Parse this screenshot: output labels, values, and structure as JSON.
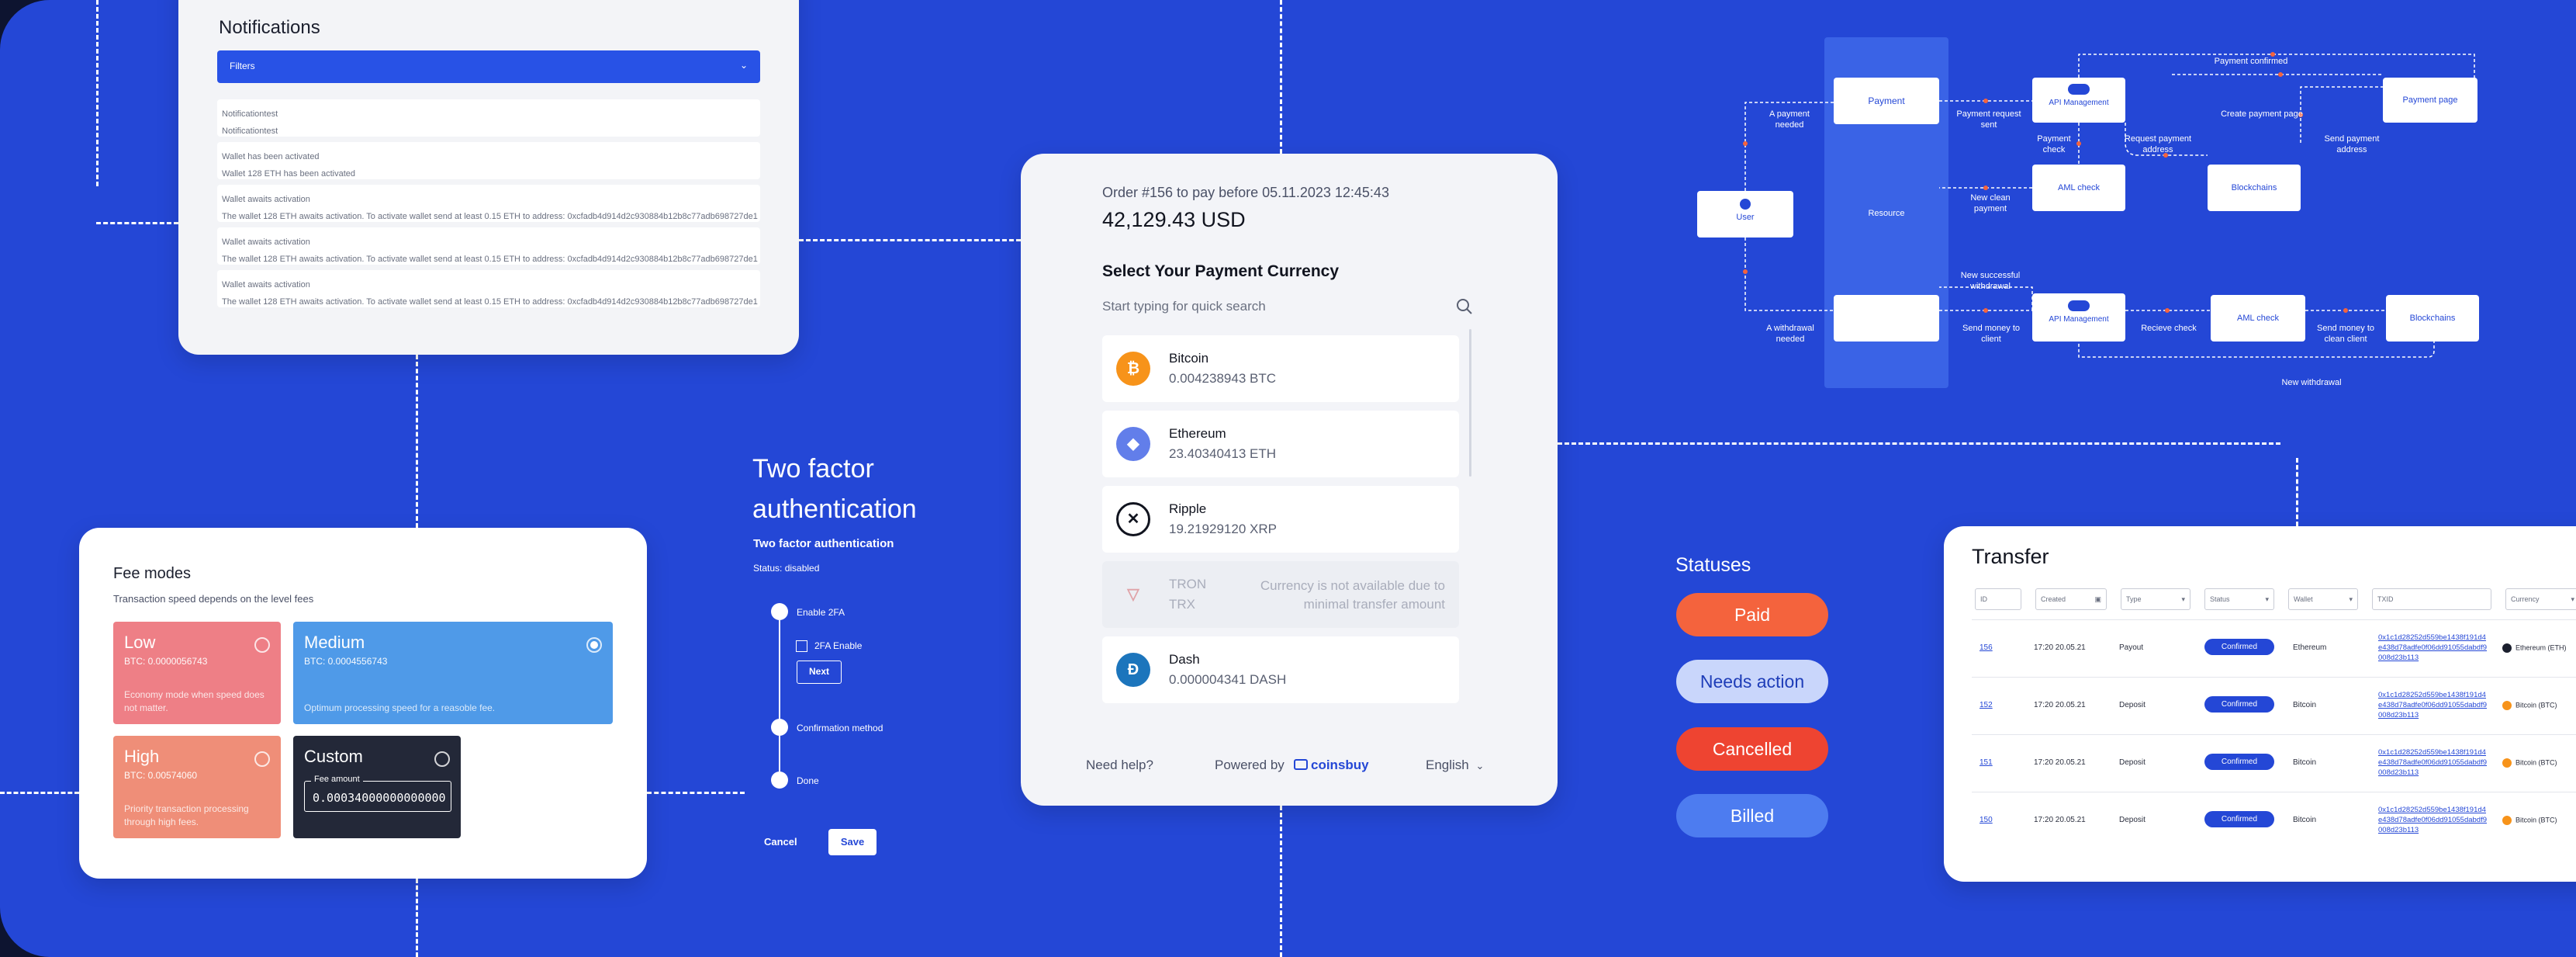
{
  "notifications": {
    "title": "Notifications",
    "filter_label": "Filters",
    "filter_chevron": "⌄",
    "items": [
      {
        "title": "Notificationtest",
        "body": "Notificationtest"
      },
      {
        "title": "Wallet has been activated",
        "body": "Wallet 128 ETH has been activated"
      },
      {
        "title": "Wallet awaits activation",
        "body": "The wallet 128 ETH awaits activation. To activate wallet send at least 0.15 ETH to address: 0xcfadb4d914d2c930884b12b8c77adb698727de1"
      },
      {
        "title": "Wallet awaits activation",
        "body": "The wallet 128 ETH awaits activation. To activate wallet send at least 0.15 ETH to address: 0xcfadb4d914d2c930884b12b8c77adb698727de1"
      },
      {
        "title": "Wallet awaits activation",
        "body": "The wallet 128 ETH awaits activation. To activate wallet send at least 0.15 ETH to address: 0xcfadb4d914d2c930884b12b8c77adb698727de1"
      }
    ]
  },
  "fee": {
    "title": "Fee modes",
    "subtitle": "Transaction speed depends on the level fees",
    "modes": [
      {
        "name": "Low",
        "btc": "BTC: 0.0000056743",
        "desc": "Economy mode when speed does not matter.",
        "color": "#ee7f86",
        "selected": false
      },
      {
        "name": "Medium",
        "btc": "BTC: 0.0004556743",
        "desc": "Optimum processing speed for a reasoble fee.",
        "color": "#4f9ae8",
        "selected": true
      },
      {
        "name": "High",
        "btc": "BTC: 0.00574060",
        "desc": "Priority transaction processing through high fees.",
        "color": "#ef8e78",
        "selected": false
      },
      {
        "name": "Custom",
        "btc": "",
        "desc": "",
        "color": "#232838",
        "selected": false
      }
    ],
    "custom_field_label": "Fee amount",
    "custom_field_value": "0.00034000000000000"
  },
  "tfa": {
    "title": "Two factor authentication",
    "subtitle": "Two factor authentication",
    "status": "Status: disabled",
    "steps": [
      "Enable 2FA",
      "Confirmation method",
      "Done"
    ],
    "checkbox_label": "2FA Enable",
    "next": "Next",
    "cancel": "Cancel",
    "save": "Save"
  },
  "payment": {
    "order": "Order #156 to pay before 05.11.2023 12:45:43",
    "amount": "42,129.43 USD",
    "select_title": "Select Your Payment Currency",
    "search_placeholder": "Start typing for quick search",
    "coins": [
      {
        "name": "Bitcoin",
        "balance": "0.004238943 BTC",
        "symbol": "₿",
        "color": "#f7931a",
        "available": true,
        "note": ""
      },
      {
        "name": "Ethereum",
        "balance": "23.40340413 ETH",
        "symbol": "◆",
        "color": "#627eea",
        "available": true,
        "note": ""
      },
      {
        "name": "Ripple",
        "balance": "19.21929120 XRP",
        "symbol": "✕",
        "color": "#11141f",
        "available": true,
        "note": ""
      },
      {
        "name": "TRON",
        "balance": "TRX",
        "symbol": "▽",
        "color": "#e0a3a8",
        "available": false,
        "note": "Currency is not available due to minimal transfer amount"
      },
      {
        "name": "Dash",
        "balance": "0.000004341 DASH",
        "symbol": "Đ",
        "color": "#1c75bc",
        "available": true,
        "note": ""
      }
    ],
    "help": "Need help?",
    "powered_by": "Powered by",
    "brand": "coinsbuy",
    "language": "English"
  },
  "statuses": {
    "title": "Statuses",
    "items": [
      {
        "label": "Paid",
        "bg": "#f4633d",
        "fg": "#ffffff"
      },
      {
        "label": "Needs action",
        "bg": "#c9d6fb",
        "fg": "#1e3db8"
      },
      {
        "label": "Cancelled",
        "bg": "#ee4431",
        "fg": "#ffffff"
      },
      {
        "label": "Billed",
        "bg": "#4d7cf0",
        "fg": "#ffffff"
      }
    ]
  },
  "transfer": {
    "title": "Transfer",
    "filters": [
      "ID",
      "Created",
      "Type",
      "Status",
      "Wallet",
      "TXID",
      "Currency"
    ],
    "rows": [
      {
        "id": "156",
        "created": "17:20 20.05.21",
        "type": "Payout",
        "status": "Confirmed",
        "wallet": "Ethereum",
        "txid": "0x1c1d28252d559be1438f191d4e438d78adfe0f06dd91055dabdf9008d23b113",
        "currency": "Ethereum (ETH)"
      },
      {
        "id": "152",
        "created": "17:20 20.05.21",
        "type": "Deposit",
        "status": "Confirmed",
        "wallet": "Bitcoin",
        "txid": "0x1c1d28252d559be1438f191d4e438d78adfe0f06dd91055dabdf9008d23b113",
        "currency": "Bitcoin (BTC)"
      },
      {
        "id": "151",
        "created": "17:20 20.05.21",
        "type": "Deposit",
        "status": "Confirmed",
        "wallet": "Bitcoin",
        "txid": "0x1c1d28252d559be1438f191d4e438d78adfe0f06dd91055dabdf9008d23b113",
        "currency": "Bitcoin (BTC)"
      },
      {
        "id": "150",
        "created": "17:20 20.05.21",
        "type": "Deposit",
        "status": "Confirmed",
        "wallet": "Bitcoin",
        "txid": "0x1c1d28252d559be1438f191d4e438d78adfe0f06dd91055dabdf9008d23b113",
        "currency": "Bitcoin (BTC)"
      }
    ]
  },
  "flow": {
    "boxes": {
      "payment": "Payment",
      "resource": "Resource",
      "user": "User",
      "api1": "API Management",
      "api2": "API Management",
      "aml1": "AML check",
      "aml2": "AML check",
      "blockchains1": "Blockchains",
      "blockchains2": "Blockchains",
      "payment_page": "Payment page"
    },
    "labels": {
      "payment_confirmed": "Payment confirmed",
      "a_payment_needed": "A payment needed",
      "payment_request_sent": "Payment request sent",
      "create_payment_page": "Create payment page",
      "payment_check": "Payment check",
      "request_payment_address": "Request payment address",
      "send_payment_address": "Send payment address",
      "new_clean_payment": "New clean payment",
      "new_successful_withdrawal": "New successful withdrawal",
      "a_withdrawal_needed": "A withdrawal needed",
      "send_money_to_client": "Send money to client",
      "recieve_check": "Recieve check",
      "send_money_to_clean_client": "Send money to clean client",
      "new_withdrawal": "New withdrawal"
    }
  }
}
